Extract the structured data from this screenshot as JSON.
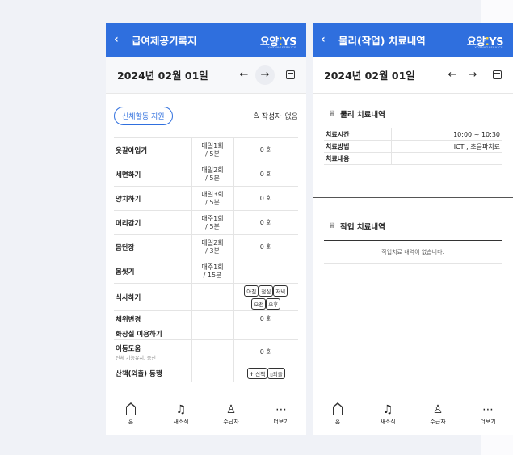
{
  "screen1": {
    "header": {
      "back": "‹",
      "title": "급여제공기록지",
      "logo": "요양",
      "logo_brand": "YS",
      "logo_sub": "YOYANGSERVICE"
    },
    "date": "2024년 02월 01일",
    "nav": {
      "prev": "←",
      "next": "→"
    },
    "pill": "신체활동 지원",
    "writer_label": "작성자",
    "writer_value": "없음",
    "rows": [
      {
        "name": "옷갈아입기",
        "freq1": "매일1회",
        "freq2": "/ 5분",
        "count": "0 회"
      },
      {
        "name": "세면하기",
        "freq1": "매일2회",
        "freq2": "/ 5분",
        "count": "0 회"
      },
      {
        "name": "양치하기",
        "freq1": "매일3회",
        "freq2": "/ 5분",
        "count": "0 회"
      },
      {
        "name": "머리감기",
        "freq1": "매주1회",
        "freq2": "/ 5분",
        "count": "0 회"
      },
      {
        "name": "몸단장",
        "freq1": "매일2회",
        "freq2": "/ 3분",
        "count": "0 회"
      },
      {
        "name": "몸씻기",
        "freq1": "매주1회",
        "freq2": "/ 15분",
        "count": ""
      }
    ],
    "meal": {
      "name": "식사하기",
      "chips_row1": [
        "아침",
        "점심",
        "저녁"
      ],
      "chips_row2": [
        "오전",
        "오후"
      ]
    },
    "posture": {
      "name": "체위변경",
      "count": "0 회"
    },
    "toilet": {
      "name": "화장실 이용하기"
    },
    "move": {
      "name": "이동도움",
      "sub": "신체 기능유지, 증진",
      "count": "0 회"
    },
    "walk": {
      "name": "산책(외출) 동행",
      "chip1": "산책",
      "chip2": "외출"
    }
  },
  "screen2": {
    "header": {
      "back": "‹",
      "title": "물리(작업) 치료내역",
      "logo": "요양",
      "logo_brand": "YS",
      "logo_sub": "YOYANGSERVICE"
    },
    "date": "2024년 02월 01일",
    "nav": {
      "prev": "←",
      "next": "→"
    },
    "physical": {
      "title": "물리 치료내역",
      "rows": [
        {
          "k": "치료시간",
          "v": "10:00 ~ 10:30"
        },
        {
          "k": "치료방법",
          "v": "ICT , 초음파치료"
        },
        {
          "k": "치료내용",
          "v": ""
        }
      ]
    },
    "occupational": {
      "title": "작업 치료내역",
      "empty": "작업치료 내역이 없습니다."
    }
  },
  "bottom_nav": [
    {
      "icon": "home-icon",
      "label": "홈"
    },
    {
      "icon": "bell-icon",
      "label": "새소식"
    },
    {
      "icon": "person-icon",
      "label": "수급자"
    },
    {
      "icon": "more-icon",
      "label": "더보기"
    }
  ]
}
